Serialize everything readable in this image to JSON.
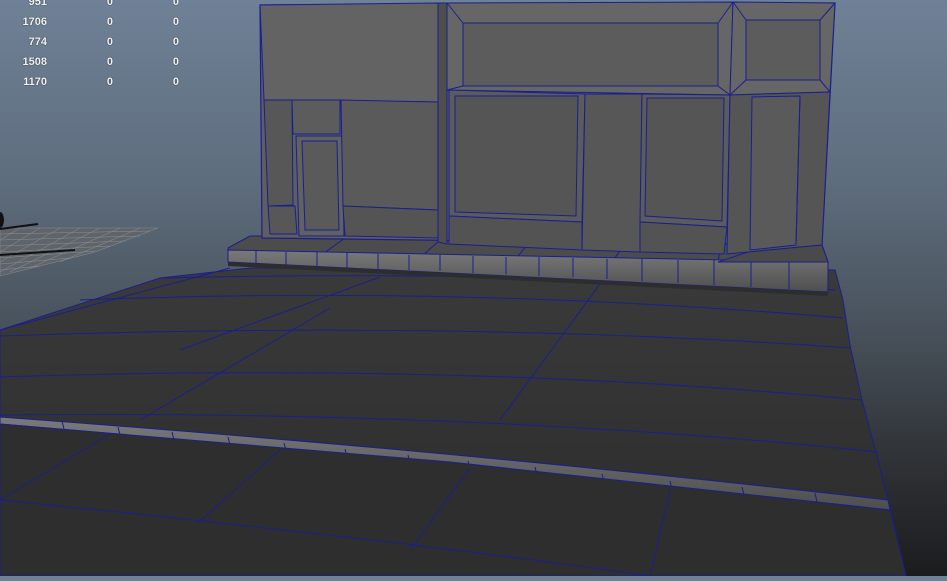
{
  "app": {
    "view": "perspective viewport",
    "theme_colors": {
      "wire": "#1a1f8f",
      "face_light": "#6c6c6c",
      "face_dark": "#3e3e3e",
      "sky_top": "#6f8196",
      "ground": "#1b1c1e"
    }
  },
  "hud": {
    "rows": [
      [
        "951",
        "0",
        "0"
      ],
      [
        "1706",
        "0",
        "0"
      ],
      [
        "774",
        "0",
        "0"
      ],
      [
        "1508",
        "0",
        "0"
      ],
      [
        "1170",
        "0",
        "0"
      ]
    ]
  },
  "scene": {
    "objects": [
      "storefront-building",
      "sidewalk",
      "curb",
      "road",
      "ground-grid"
    ]
  }
}
